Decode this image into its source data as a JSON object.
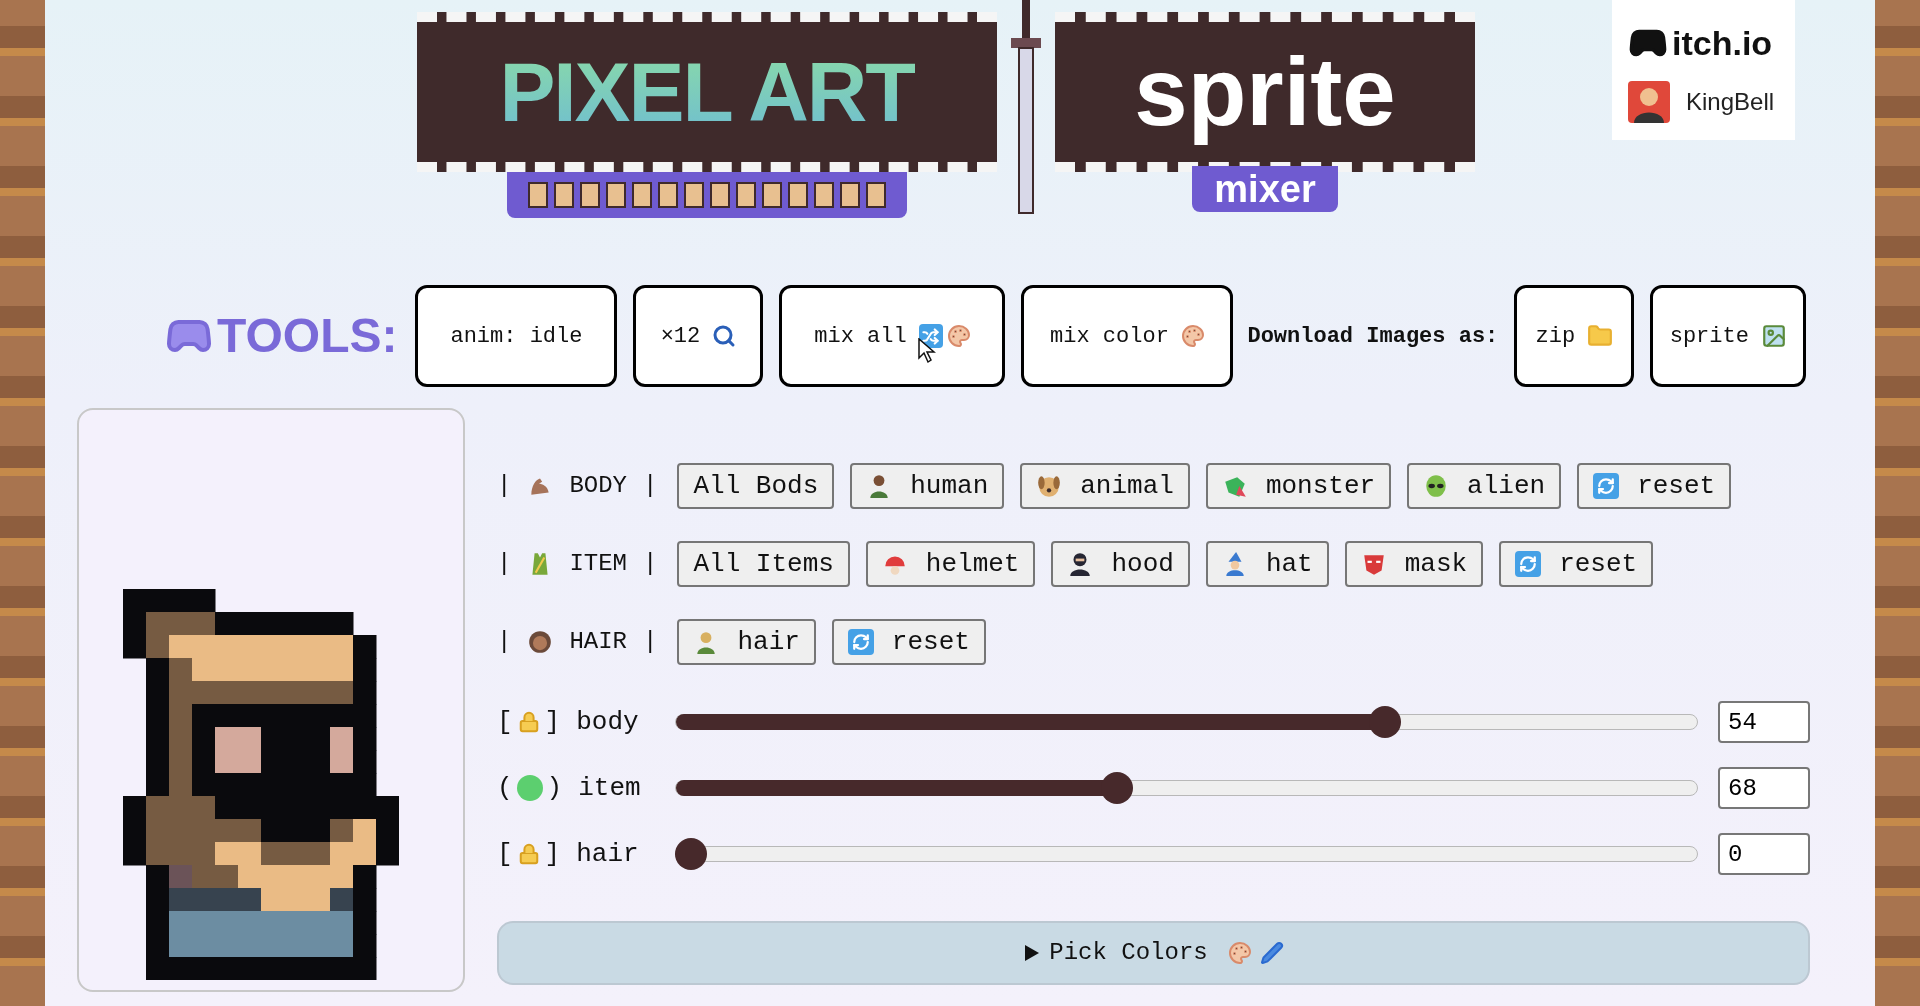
{
  "header": {
    "logo": {
      "title": "PIXEL ART",
      "subtitle": "sprite",
      "tag": "mixer"
    },
    "badge": {
      "site": "itch.io",
      "author": "KingBell"
    }
  },
  "tools": {
    "heading": "TOOLS:",
    "buttons": [
      {
        "label": "anim: idle"
      },
      {
        "label": "×12"
      },
      {
        "label": "mix all"
      },
      {
        "label": "mix color"
      }
    ],
    "download_label": "Download Images as:",
    "download_buttons": [
      {
        "label": "zip"
      },
      {
        "label": "sprite"
      }
    ]
  },
  "groups": [
    {
      "left": "|",
      "label": "BODY",
      "right": "|",
      "buttons": [
        "All Bods",
        "human",
        "animal",
        "monster",
        "alien",
        "reset"
      ]
    },
    {
      "left": "|",
      "label": "ITEM",
      "right": "|",
      "buttons": [
        "All Items",
        "helmet",
        "hood",
        "hat",
        "mask",
        "reset"
      ]
    },
    {
      "left": "|",
      "label": "HAIR",
      "right": "|",
      "buttons": [
        "hair",
        "reset"
      ]
    }
  ],
  "sliders": [
    {
      "kind": "locked",
      "open": "[",
      "close": "]",
      "label": "body",
      "level": 0.7,
      "value": "54"
    },
    {
      "kind": "color",
      "color": "#5ccf6f",
      "open": "(",
      "close": ")",
      "label": "item",
      "level": 0.43,
      "value": "68"
    },
    {
      "kind": "locked",
      "open": "[",
      "close": "]",
      "label": "hair",
      "level": 0.0,
      "value": "0"
    }
  ],
  "pick_colors": {
    "expanded": false,
    "label": "Pick Colors"
  }
}
